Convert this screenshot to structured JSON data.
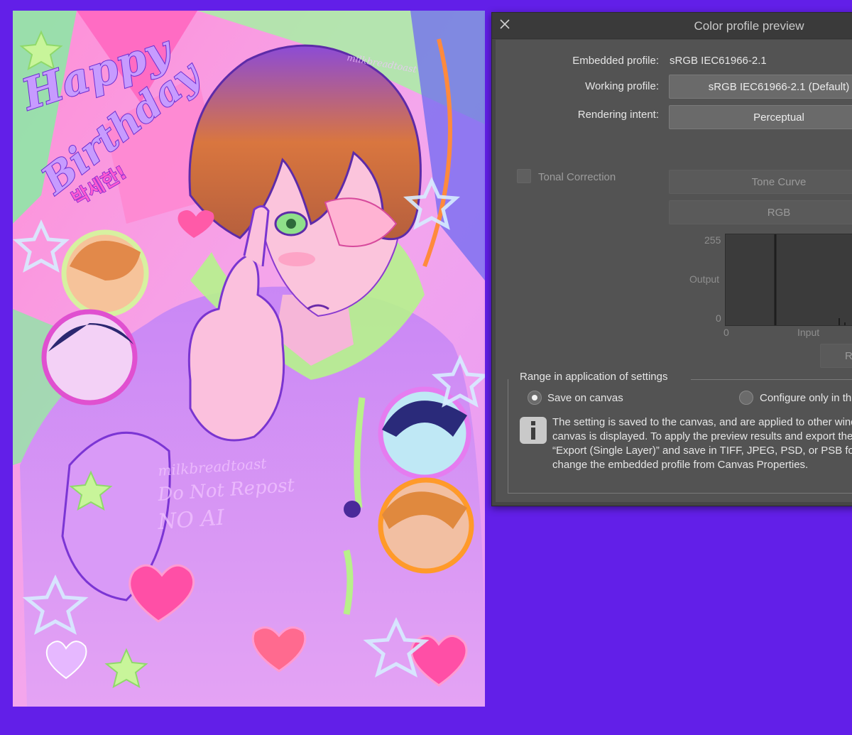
{
  "artwork": {
    "title_line1": "Happy",
    "title_line2": "Birthday",
    "korean_text": "박세한!",
    "watermark_name": "milkbreadtoast",
    "watermark_line1": "milkbreadtoast",
    "watermark_line2": "Do Not Repost",
    "watermark_line3": "NO AI"
  },
  "dialog": {
    "title": "Color profile preview",
    "close_icon": "close-icon",
    "embedded_profile_label": "Embedded profile:",
    "embedded_profile_value": "sRGB IEC61966-2.1",
    "working_profile_label": "Working profile:",
    "working_profile_value": "sRGB IEC61966-2.1 (Default)",
    "rendering_intent_label": "Rendering intent:",
    "rendering_intent_value": "Perceptual",
    "tonal_correction_label": "Tonal Correction",
    "tone_curve_button": "Tone Curve",
    "channel_button": "RGB",
    "graph": {
      "y_max": "255",
      "y_label": "Output",
      "y_min": "0",
      "x_min": "0",
      "x_label": "Input"
    },
    "reset_button": "R",
    "range_group_title": "Range in application of settings",
    "save_on_canvas_label": "Save on canvas",
    "configure_only_label": "Configure only in th",
    "info_icon": "info-icon",
    "info_lines": [
      "The setting is saved to the canvas, and are applied to other wind",
      "canvas is displayed. To apply the preview results and export the",
      "“Export (Single Layer)” and save in TIFF, JPEG, PSD, or PSB form",
      "change the embedded profile from Canvas Properties."
    ]
  },
  "colors": {
    "background": "#621fe8",
    "dialog_bg": "#535353",
    "dialog_title_bg": "#3a3a3a"
  }
}
